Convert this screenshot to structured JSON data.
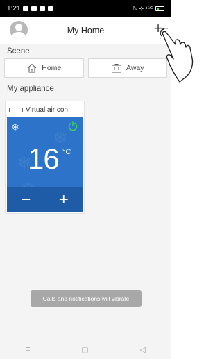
{
  "status_bar": {
    "time": "1:21",
    "right_text": "ℕ ⊹ ⁴⁶ᴳ"
  },
  "header": {
    "title": "My Home",
    "add_label": "+"
  },
  "scene": {
    "label": "Scene",
    "buttons": [
      {
        "label": "Home",
        "icon": "house-icon"
      },
      {
        "label": "Away",
        "icon": "luggage-icon"
      }
    ]
  },
  "appliances": {
    "label": "My appliance",
    "items": [
      {
        "name": "Virtual air con",
        "temperature": "16",
        "unit": "°C",
        "mode": "snowflake-icon",
        "power_color": "#3bd15c",
        "minus": "−",
        "plus": "+"
      }
    ]
  },
  "toast": {
    "text": "Calls and notifications will vibrate"
  },
  "nav": {
    "menu": "≡",
    "home": "▢",
    "back": "◁"
  },
  "colors": {
    "ac_panel": "#2c73c9",
    "ac_bottom": "#1f5ca8"
  }
}
